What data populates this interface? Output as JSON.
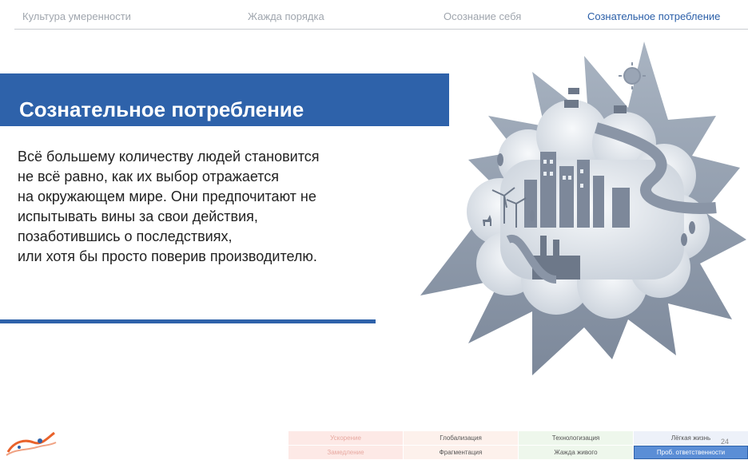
{
  "nav": {
    "tabs": [
      {
        "label": "Культура умеренности"
      },
      {
        "label": "Жажда порядка"
      },
      {
        "label": "Осознание себя"
      },
      {
        "label": "Сознательное потребление"
      }
    ],
    "active_index": 3
  },
  "slide": {
    "title": "Сознательное потребление",
    "body_lines": [
      "Всё большему количеству людей становится",
      "не всё равно, как их выбор отражается",
      "на окружающем мире. Они предпочитают не",
      "испытывать вины за свои действия,",
      "позаботившись о последствиях,",
      "или хотя бы просто поверив производителю."
    ]
  },
  "grid": {
    "row1": [
      "Ускорение",
      "Глобализация",
      "Технологизация",
      "Лёгкая жизнь"
    ],
    "row2": [
      "Замедление",
      "Фрагментация",
      "Жажда живого",
      "Проб. ответственности"
    ]
  },
  "page_number": "24",
  "colors": {
    "accent": "#2e62aa",
    "nav_inactive": "#a0a6ae",
    "illustration": "#8c98a8"
  },
  "icons": {
    "illustration": "city-ecology-illustration",
    "logo": "brand-logo"
  }
}
